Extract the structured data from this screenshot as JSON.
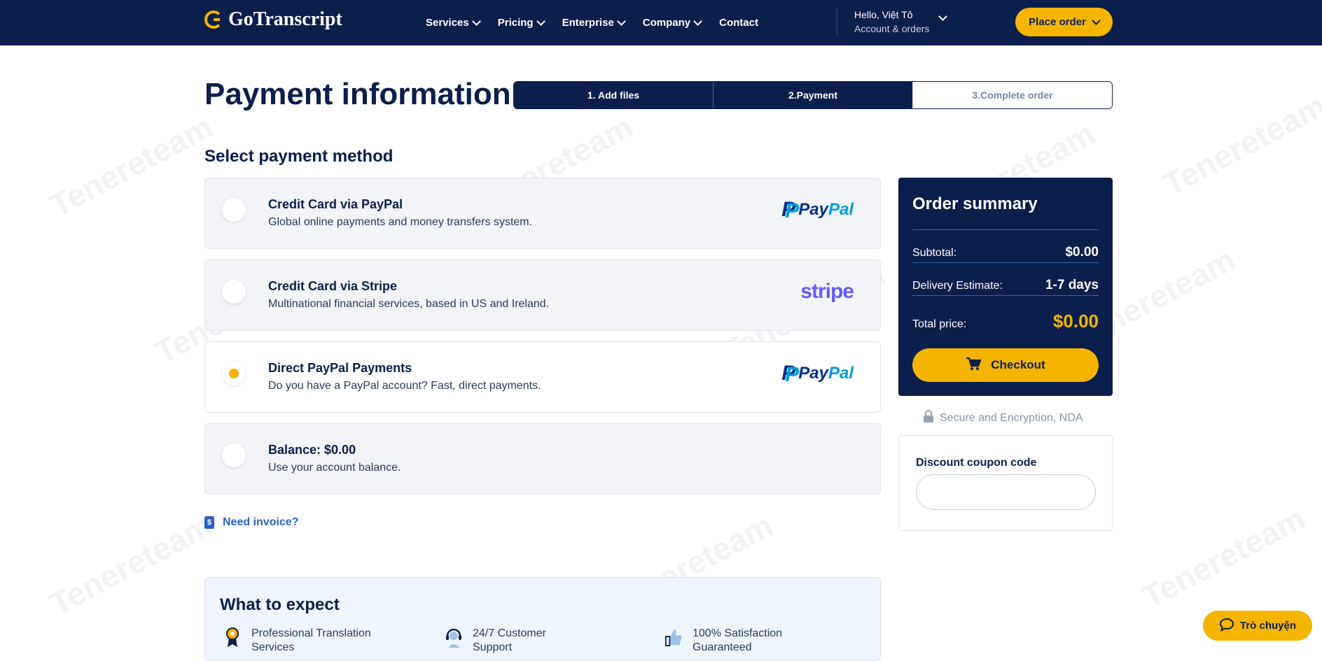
{
  "header": {
    "logo_text": "GoTranscript",
    "nav": [
      "Services",
      "Pricing",
      "Enterprise",
      "Company",
      "Contact"
    ],
    "greeting": "Hello, Việt Tô",
    "account_label": "Account & orders",
    "place_order": "Place order"
  },
  "page_title": "Payment information",
  "steps": [
    "1. Add files",
    "2.Payment",
    "3.Complete order"
  ],
  "section_title": "Select payment method",
  "payment_options": [
    {
      "title": "Credit Card via PayPal",
      "desc": "Global online payments and money transfers system.",
      "logo": "PayPal",
      "selected": false
    },
    {
      "title": "Credit Card via Stripe",
      "desc": "Multinational financial services, based in US and Ireland.",
      "logo": "stripe",
      "selected": false
    },
    {
      "title": "Direct PayPal Payments",
      "desc": "Do you have a PayPal account? Fast, direct payments.",
      "logo": "PayPal",
      "selected": true
    },
    {
      "title": "Balance: $0.00",
      "desc": "Use your account balance.",
      "logo": "",
      "selected": false
    }
  ],
  "invoice_link": "Need invoice?",
  "expect": {
    "title": "What to expect",
    "items": [
      "Professional Translation Services",
      "24/7 Customer Support",
      "100% Satisfaction Guaranteed"
    ]
  },
  "summary": {
    "title": "Order summary",
    "subtotal_label": "Subtotal:",
    "subtotal": "$0.00",
    "delivery_label": "Delivery Estimate:",
    "delivery": "1-7 days",
    "total_label": "Total price:",
    "total": "$0.00",
    "checkout": "Checkout"
  },
  "secure_text": "Secure and Encryption, NDA",
  "coupon_label": "Discount coupon code",
  "chat_label": "Trò chuyện",
  "watermark": "Tenereteam",
  "colors": {
    "navy": "#0b1f4d",
    "accent": "#f5b400",
    "link": "#2a5fc8",
    "stripe": "#635bff"
  }
}
